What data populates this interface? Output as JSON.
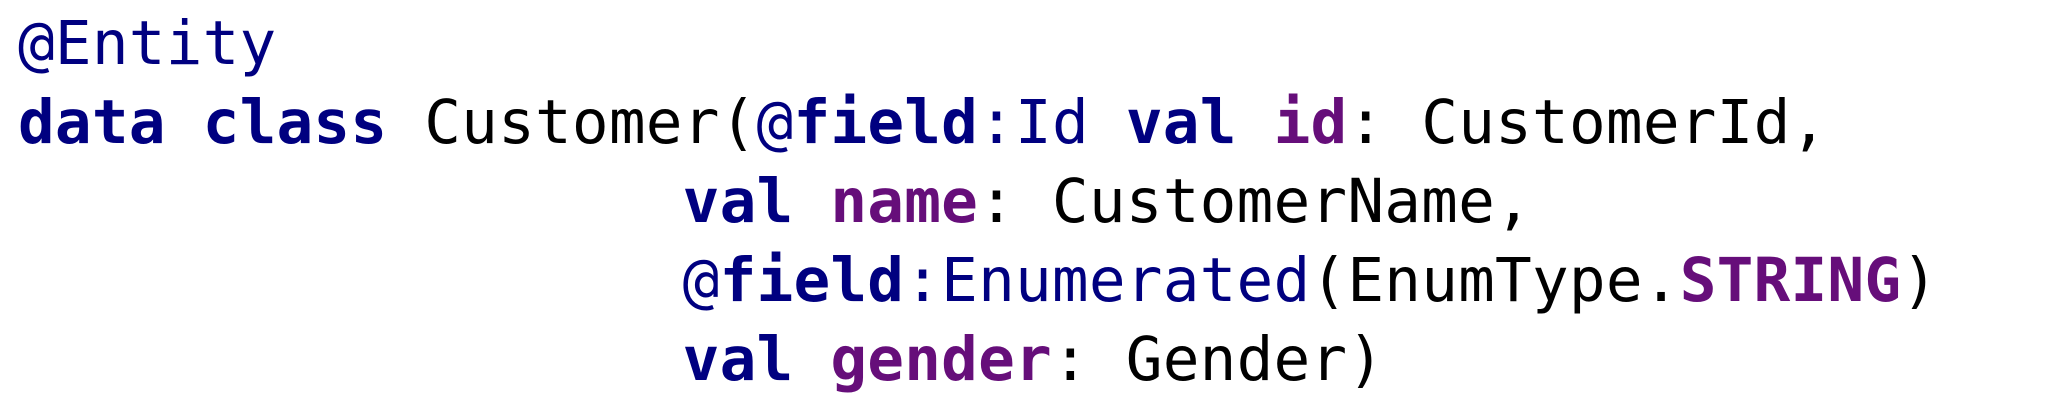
{
  "code": {
    "line1": {
      "annotation": "@Entity"
    },
    "line2": {
      "kw_data": "data",
      "sp1": " ",
      "kw_class": "class",
      "sp2": " ",
      "class_name": "Customer(",
      "at": "@",
      "field_kw": "field",
      "colon_anno": ":Id",
      "sp3": " ",
      "kw_val": "val",
      "sp4": " ",
      "prop_name": "id",
      "type_part": ": CustomerId,"
    },
    "line3": {
      "indent": "                  ",
      "kw_val": "val",
      "sp": " ",
      "prop_name": "name",
      "type_part": ": CustomerName,"
    },
    "line4": {
      "indent": "                  ",
      "at": "@",
      "field_kw": "field",
      "anno_rest": ":Enumerated",
      "paren_open": "(EnumType.",
      "enum_value": "STRING",
      "paren_close": ")"
    },
    "line5": {
      "indent": "                  ",
      "kw_val": "val",
      "sp": " ",
      "prop_name": "gender",
      "type_part": ": Gender)"
    }
  }
}
